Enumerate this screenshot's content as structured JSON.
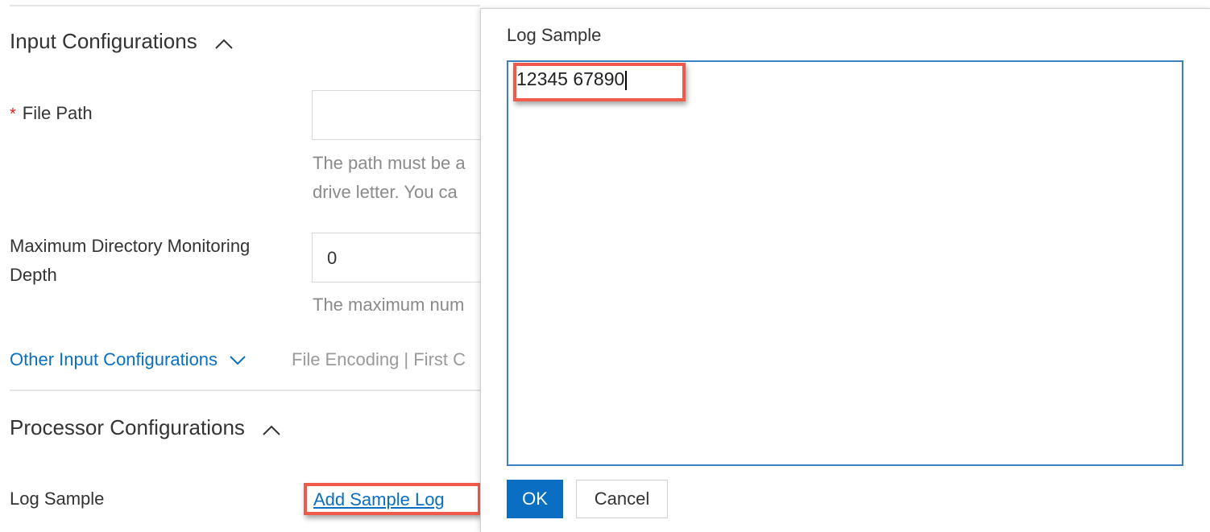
{
  "input_config": {
    "title": "Input Configurations",
    "file_path": {
      "label": "File Path",
      "required_mark": "*",
      "value": "",
      "help_line1": "The path must be a",
      "help_line2": "drive letter. You ca"
    },
    "max_depth": {
      "label_line1": "Maximum Directory Monitoring",
      "label_line2": "Depth",
      "value": "0",
      "help": "The maximum num"
    },
    "other_link": "Other Input Configurations",
    "other_meta": "File Encoding | First C"
  },
  "processor_config": {
    "title": "Processor Configurations",
    "log_sample_label": "Log Sample",
    "add_sample_link": "Add Sample Log"
  },
  "dialog": {
    "title": "Log Sample",
    "sample_text": "12345 67890",
    "ok_label": "OK",
    "cancel_label": "Cancel"
  },
  "colors": {
    "link": "#0a6fc2",
    "primary_button": "#0a6fc2",
    "highlight": "#f05a4b",
    "required": "#e02020"
  },
  "icons": {
    "collapse": "chevron-up-icon",
    "expand": "chevron-down-icon"
  }
}
